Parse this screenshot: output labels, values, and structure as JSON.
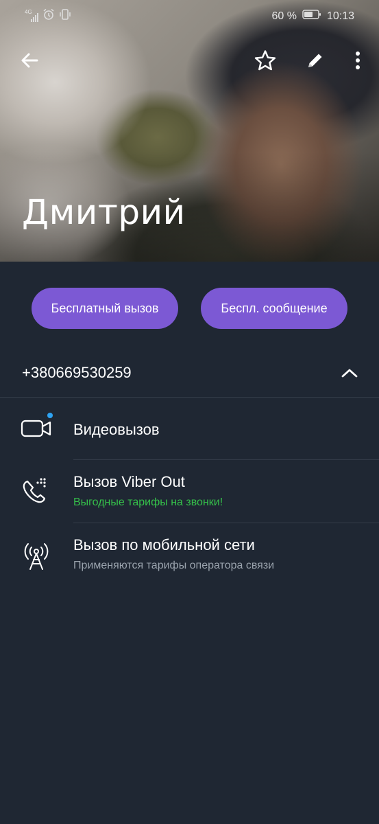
{
  "status_bar": {
    "network": "4G",
    "battery_percent": "60 %",
    "time": "10:13"
  },
  "contact": {
    "name": "Дмитрий",
    "phone": "+380669530259"
  },
  "actions": {
    "free_call": "Бесплатный вызов",
    "free_message": "Беспл. сообщение"
  },
  "options": [
    {
      "title": "Видеовызов",
      "subtitle": ""
    },
    {
      "title": "Вызов Viber Out",
      "subtitle": "Выгодные тарифы на звонки!"
    },
    {
      "title": "Вызов по мобильной сети",
      "subtitle": "Применяются тарифы оператора связи"
    }
  ],
  "colors": {
    "background": "#1f2733",
    "accent": "#7c59d4",
    "promo_green": "#35c04a",
    "subtitle_gray": "#9aa3ad",
    "dot_blue": "#2ea3f2"
  },
  "icons": {
    "back": "back-arrow-icon",
    "favorite": "star-icon",
    "edit": "pencil-icon",
    "more": "more-vertical-icon",
    "collapse": "chevron-up-icon",
    "video": "video-camera-icon",
    "viber_out": "phone-keypad-icon",
    "mobile": "antenna-icon"
  }
}
